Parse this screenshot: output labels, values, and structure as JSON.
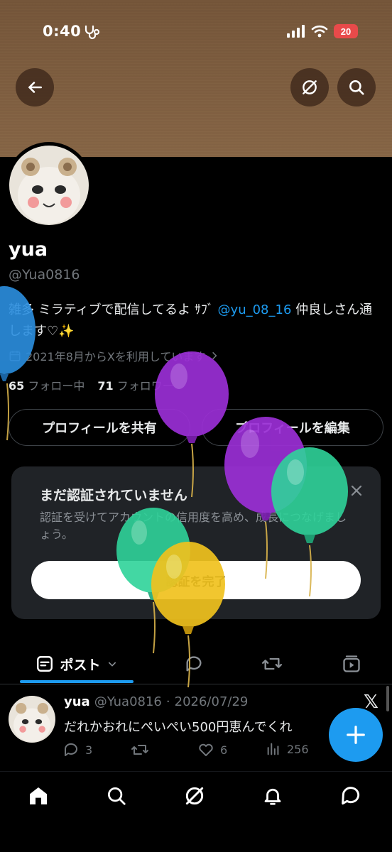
{
  "status_bar": {
    "time": "0:40",
    "battery": "20"
  },
  "header": {
    "back": "back-arrow-icon",
    "grok": "grok-icon",
    "search": "search-icon"
  },
  "profile": {
    "name": "yua",
    "handle": "@Yua0816",
    "bio_pre": "雑多 ミラティブで配信してるよ ｻﾌﾞ ",
    "bio_link": "@yu_08_16",
    "bio_post": " 仲良しさん通します♡✨",
    "joined": "2021年8月からXを利用しています",
    "following_count": "65",
    "following_label": "フォロー中",
    "followers_count": "71",
    "followers_label": "フォロワー",
    "share_button": "プロフィールを共有",
    "edit_button": "プロフィールを編集"
  },
  "verify_card": {
    "title": "まだ認証されていません",
    "description": "認証を受けてアカウントの信用度を高め、成長につなげましょう。",
    "cta": "認証を完了"
  },
  "tabs": {
    "posts_label": "ポスト"
  },
  "post": {
    "name": "yua",
    "handle": "@Yua0816",
    "separator": "·",
    "date": "2026/07/29",
    "text": "だれかおれにぺいぺい500円恵んでくれ",
    "replies": "3",
    "likes": "6",
    "views": "256"
  },
  "colors": {
    "accent": "#1d9bf0",
    "background": "#000000",
    "card": "#202327"
  }
}
